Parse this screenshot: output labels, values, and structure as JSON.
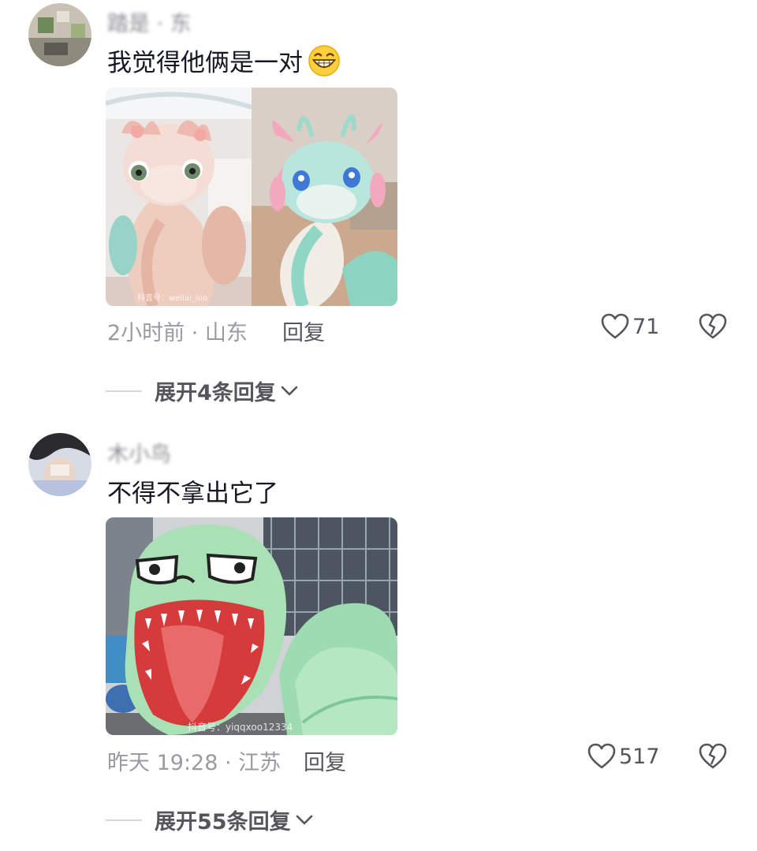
{
  "comments": [
    {
      "username": "踏是 · 东",
      "text": "我觉得他俩是一对",
      "meta": "2小时前 · 山东",
      "reply_label": "回复",
      "likes": "71",
      "expand_label": "展开4条回复",
      "watermark": "抖音号：weilai_luo"
    },
    {
      "username": "木小鸟",
      "text": "不得不拿出它了",
      "meta": "昨天 19:28 · 江苏",
      "reply_label": "回复",
      "likes": "517",
      "expand_label": "展开55条回复",
      "watermark": "抖音号：yiqqxoo12334"
    }
  ],
  "colors": {
    "text_primary": "#161823",
    "text_secondary": "#9a9ba1",
    "divider": "#d8d8da"
  },
  "icons": [
    "grin-emoji-icon",
    "heart-icon",
    "broken-heart-icon",
    "chevron-down-icon"
  ]
}
